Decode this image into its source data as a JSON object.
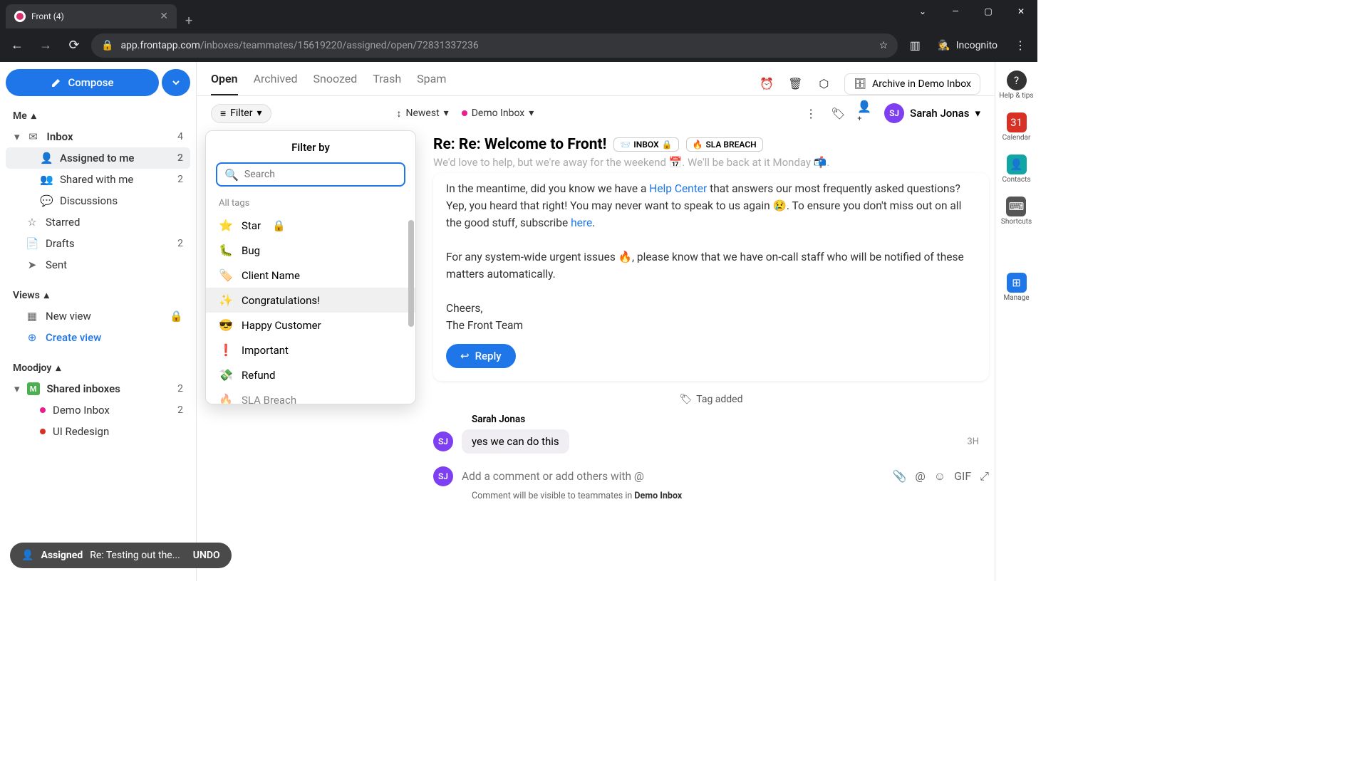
{
  "browser": {
    "tab_title": "Front (4)",
    "url_domain": "app.frontapp.com",
    "url_path": "/inboxes/teammates/15619220/assigned/open/72831337236",
    "incognito": "Incognito"
  },
  "sidebar": {
    "compose": "Compose",
    "me": "Me",
    "inbox": {
      "label": "Inbox",
      "count": "4"
    },
    "assigned": {
      "label": "Assigned to me",
      "count": "2"
    },
    "shared": {
      "label": "Shared with me",
      "count": "2"
    },
    "discussions": {
      "label": "Discussions"
    },
    "starred": {
      "label": "Starred"
    },
    "drafts": {
      "label": "Drafts",
      "count": "2"
    },
    "sent": {
      "label": "Sent"
    },
    "views": "Views",
    "new_view": "New view",
    "create_view": "Create view",
    "moodjoy": "Moodjoy",
    "shared_inboxes": {
      "label": "Shared inboxes",
      "count": "2"
    },
    "demo_inbox": {
      "label": "Demo Inbox",
      "count": "2"
    },
    "ui_redesign": {
      "label": "UI Redesign"
    }
  },
  "tabs": {
    "open": "Open",
    "archived": "Archived",
    "snoozed": "Snoozed",
    "trash": "Trash",
    "spam": "Spam",
    "archive_in": "Archive in Demo Inbox"
  },
  "filter_row": {
    "filter": "Filter",
    "sort": "Newest",
    "inbox": "Demo Inbox",
    "assignee": "Sarah Jonas",
    "initials": "SJ"
  },
  "filter_dropdown": {
    "title": "Filter by",
    "search_placeholder": "Search",
    "section": "All tags",
    "items": [
      {
        "icon": "⭐",
        "label": "Star",
        "locked": true
      },
      {
        "icon": "🐛",
        "label": "Bug"
      },
      {
        "icon": "🏷️",
        "label": "Client Name"
      },
      {
        "icon": "✨",
        "label": "Congratulations!"
      },
      {
        "icon": "😎",
        "label": "Happy Customer"
      },
      {
        "icon": "❗",
        "label": "Important"
      },
      {
        "icon": "💸",
        "label": "Refund"
      },
      {
        "icon": "🔥",
        "label": "SLA Breach"
      }
    ]
  },
  "message": {
    "subject": "Re: Re: Welcome to Front!",
    "tag1": "INBOX",
    "tag2": "SLA BREACH",
    "cut_line": "We'd love to help, but we're away for the weekend 📅. We'll be back at it Monday 📬.",
    "p1a": "In the meantime, did you know we have a ",
    "p1_link1": "Help Center",
    "p1b": " that answers our most frequently asked questions? Yep, you heard that right! You may never want to speak to us again 😢. To ensure you don't miss out on all the good stuff, subscribe ",
    "p1_link2": "here",
    "p1c": ".",
    "p2": "For any system-wide urgent issues 🔥, please know that we have on-call staff who will be notified of these matters automatically.",
    "signoff1": "Cheers,",
    "signoff2": "The Front Team",
    "reply": "Reply",
    "activity": "Tag added",
    "comment_author": "Sarah Jonas",
    "comment_text": "yes we can do this",
    "comment_time": "3H",
    "composer_placeholder": "Add a comment or add others with @",
    "composer_hint_a": "Comment will be visible to teammates in ",
    "composer_hint_b": "Demo Inbox"
  },
  "rail": {
    "help": "Help & tips",
    "calendar": "Calendar",
    "contacts": "Contacts",
    "shortcuts": "Shortcuts",
    "manage": "Manage"
  },
  "toast": {
    "prefix": "Assigned",
    "text": "Re: Testing out the...",
    "undo": "UNDO"
  }
}
